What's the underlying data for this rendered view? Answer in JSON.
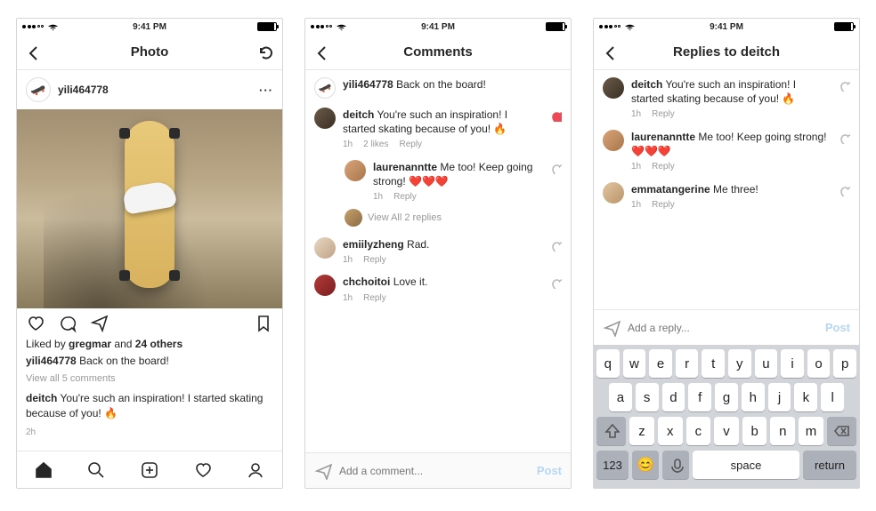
{
  "status": {
    "carrier": "●●●○○",
    "time": "9:41 PM"
  },
  "screen1": {
    "title": "Photo",
    "post": {
      "author": "yili464778",
      "liked_by_user": "gregmar",
      "liked_by_others": "24 others",
      "caption_user": "yili464778",
      "caption_text": "Back on the board!",
      "view_all": "View all 5 comments",
      "top_comment_user": "deitch",
      "top_comment_text": "You're such an inspiration! I started skating because of you! 🔥",
      "age": "2h"
    }
  },
  "screen2": {
    "title": "Comments",
    "caption": {
      "user": "yili464778",
      "text": "Back on the board!"
    },
    "comments": [
      {
        "user": "deitch",
        "text": "You're such an inspiration! I started skating because of you! 🔥",
        "age": "1h",
        "likes": "2 likes",
        "liked": true
      },
      {
        "user": "laurenanntte",
        "text": "Me too! Keep going strong! ❤️❤️❤️",
        "age": "1h",
        "reply": true
      },
      {
        "user_label": "View All 2 replies"
      },
      {
        "user": "emiilyzheng",
        "text": "Rad.",
        "age": "1h"
      },
      {
        "user": "chchoitoi",
        "text": "Love it.",
        "age": "1h"
      }
    ],
    "composer": {
      "placeholder": "Add a comment...",
      "post": "Post"
    }
  },
  "screen3": {
    "title": "Replies to deitch",
    "replies": [
      {
        "user": "deitch",
        "text": "You're such an inspiration! I started skating because of you! 🔥",
        "age": "1h"
      },
      {
        "user": "laurenanntte",
        "text": "Me too! Keep going strong! ❤️❤️❤️",
        "age": "1h"
      },
      {
        "user": "emmatangerine",
        "text": "Me three!",
        "age": "1h"
      }
    ],
    "composer": {
      "placeholder": "Add a reply...",
      "post": "Post"
    },
    "keyboard": {
      "row1": [
        "q",
        "w",
        "e",
        "r",
        "t",
        "y",
        "u",
        "i",
        "o",
        "p"
      ],
      "row2": [
        "a",
        "s",
        "d",
        "f",
        "g",
        "h",
        "j",
        "k",
        "l"
      ],
      "row3": [
        "z",
        "x",
        "c",
        "v",
        "b",
        "n",
        "m"
      ],
      "numkey": "123",
      "space": "space",
      "return": "return"
    }
  },
  "meta": {
    "reply_label": "Reply"
  }
}
